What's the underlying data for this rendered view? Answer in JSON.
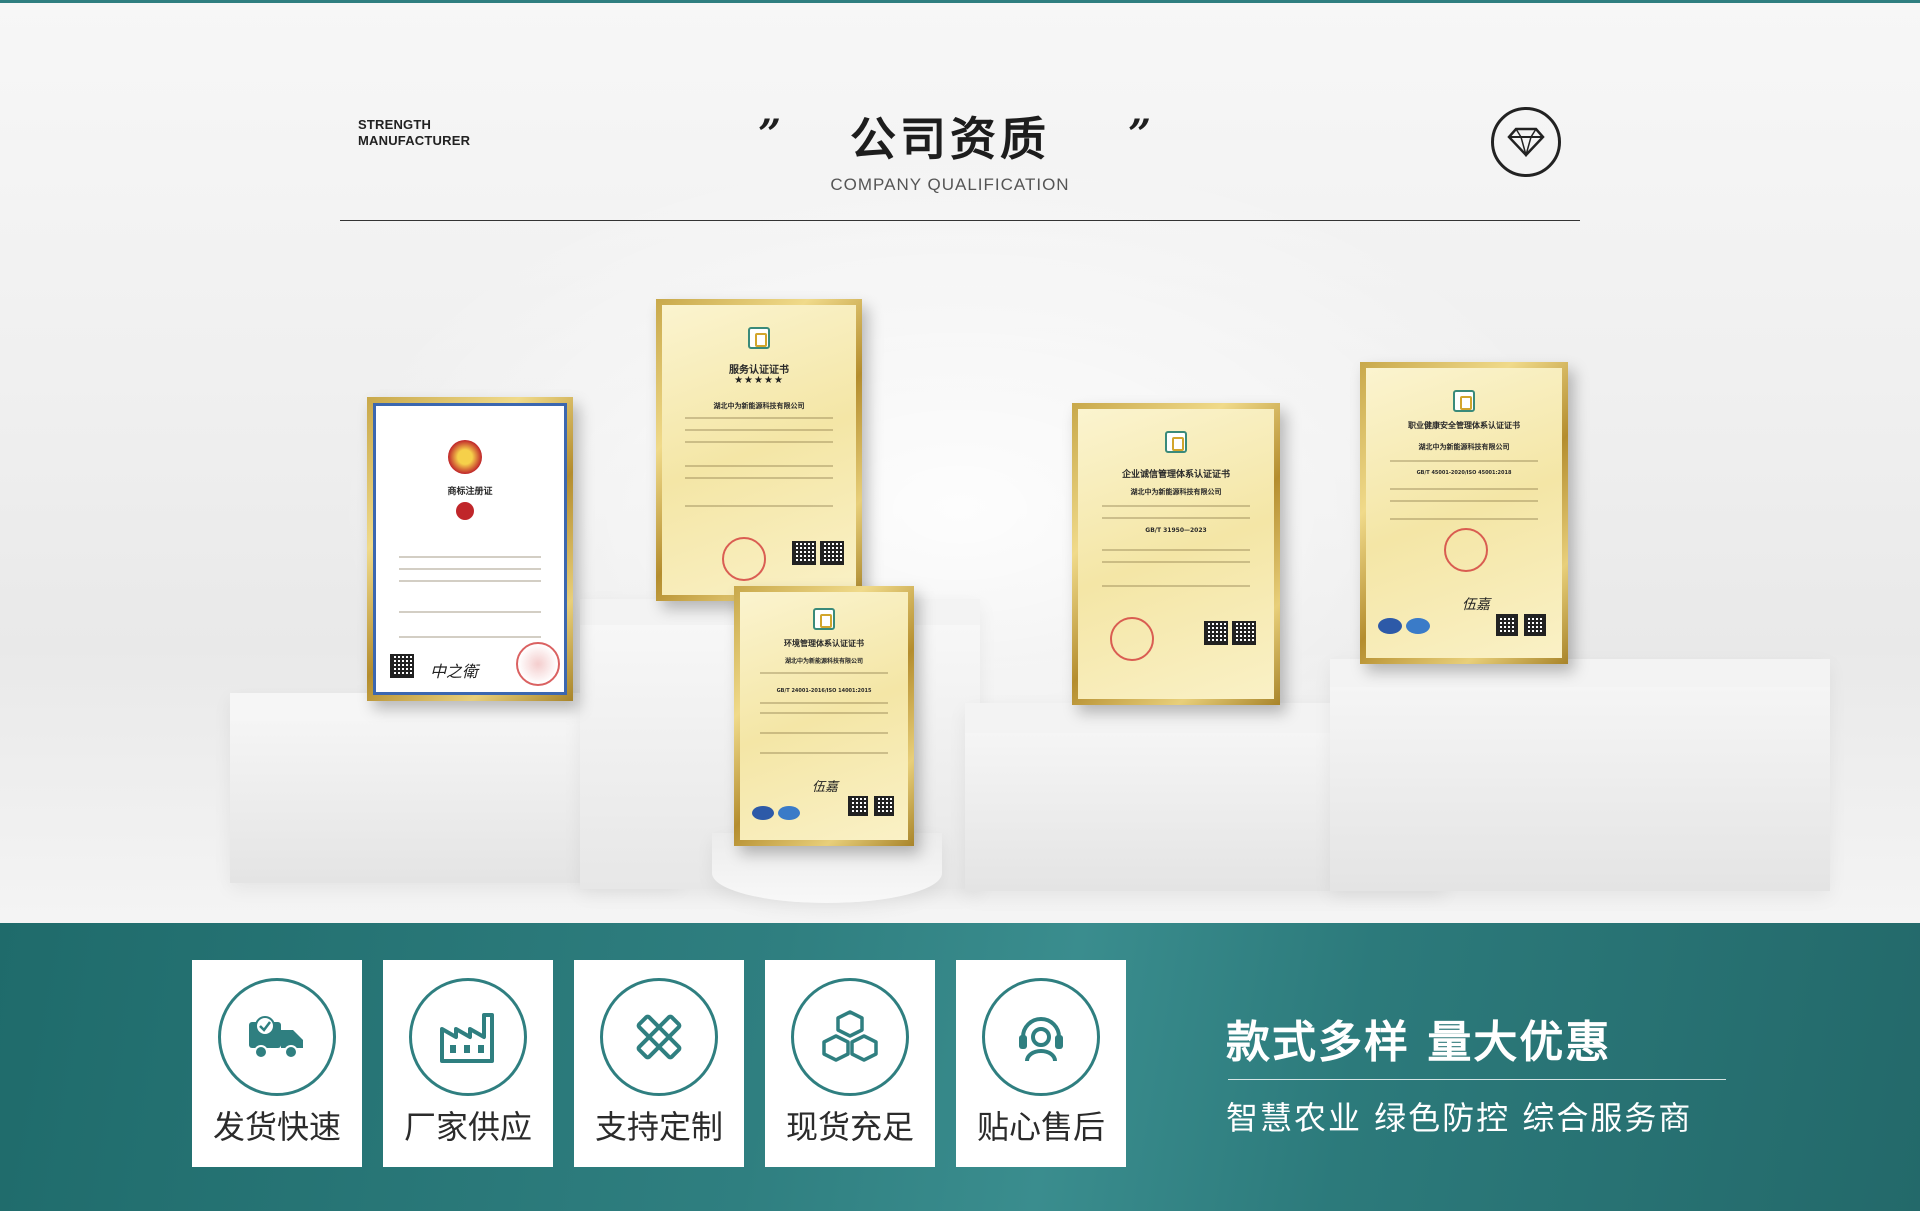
{
  "header": {
    "strength_line1": "STRENGTH",
    "strength_line2": "MANUFACTURER",
    "quote_open": "”",
    "quote_close": "”",
    "title": "公司资质",
    "subtitle": "COMPANY QUALIFICATION"
  },
  "certificates": [
    {
      "title": "商标注册证"
    },
    {
      "title": "服务认证证书",
      "stars": "★★★★★",
      "company": "湖北中为新能源科技有限公司"
    },
    {
      "title": "环境管理体系认证证书",
      "company": "湖北中为新能源科技有限公司",
      "standard": "GB/T 24001-2016/ISO 14001:2015"
    },
    {
      "title": "企业诚信管理体系认证证书",
      "company": "湖北中为新能源科技有限公司",
      "standard": "GB/T 31950—2023"
    },
    {
      "title": "职业健康安全管理体系认证证书",
      "company": "湖北中为新能源科技有限公司",
      "standard": "GB/T 45001-2020/ISO 45001:2018"
    }
  ],
  "features": [
    {
      "label": "发货快速",
      "icon": "truck-icon"
    },
    {
      "label": "厂家供应",
      "icon": "factory-icon"
    },
    {
      "label": "支持定制",
      "icon": "ruler-pencil-icon"
    },
    {
      "label": "现货充足",
      "icon": "boxes-icon"
    },
    {
      "label": "贴心售后",
      "icon": "headset-icon"
    }
  ],
  "slogan": {
    "line1": "款式多样 量大优惠",
    "line2": "智慧农业 绿色防控 综合服务商"
  },
  "colors": {
    "accent": "#2f7f80",
    "band_dark": "#1f6b6b",
    "gold": "#c8a84a"
  }
}
